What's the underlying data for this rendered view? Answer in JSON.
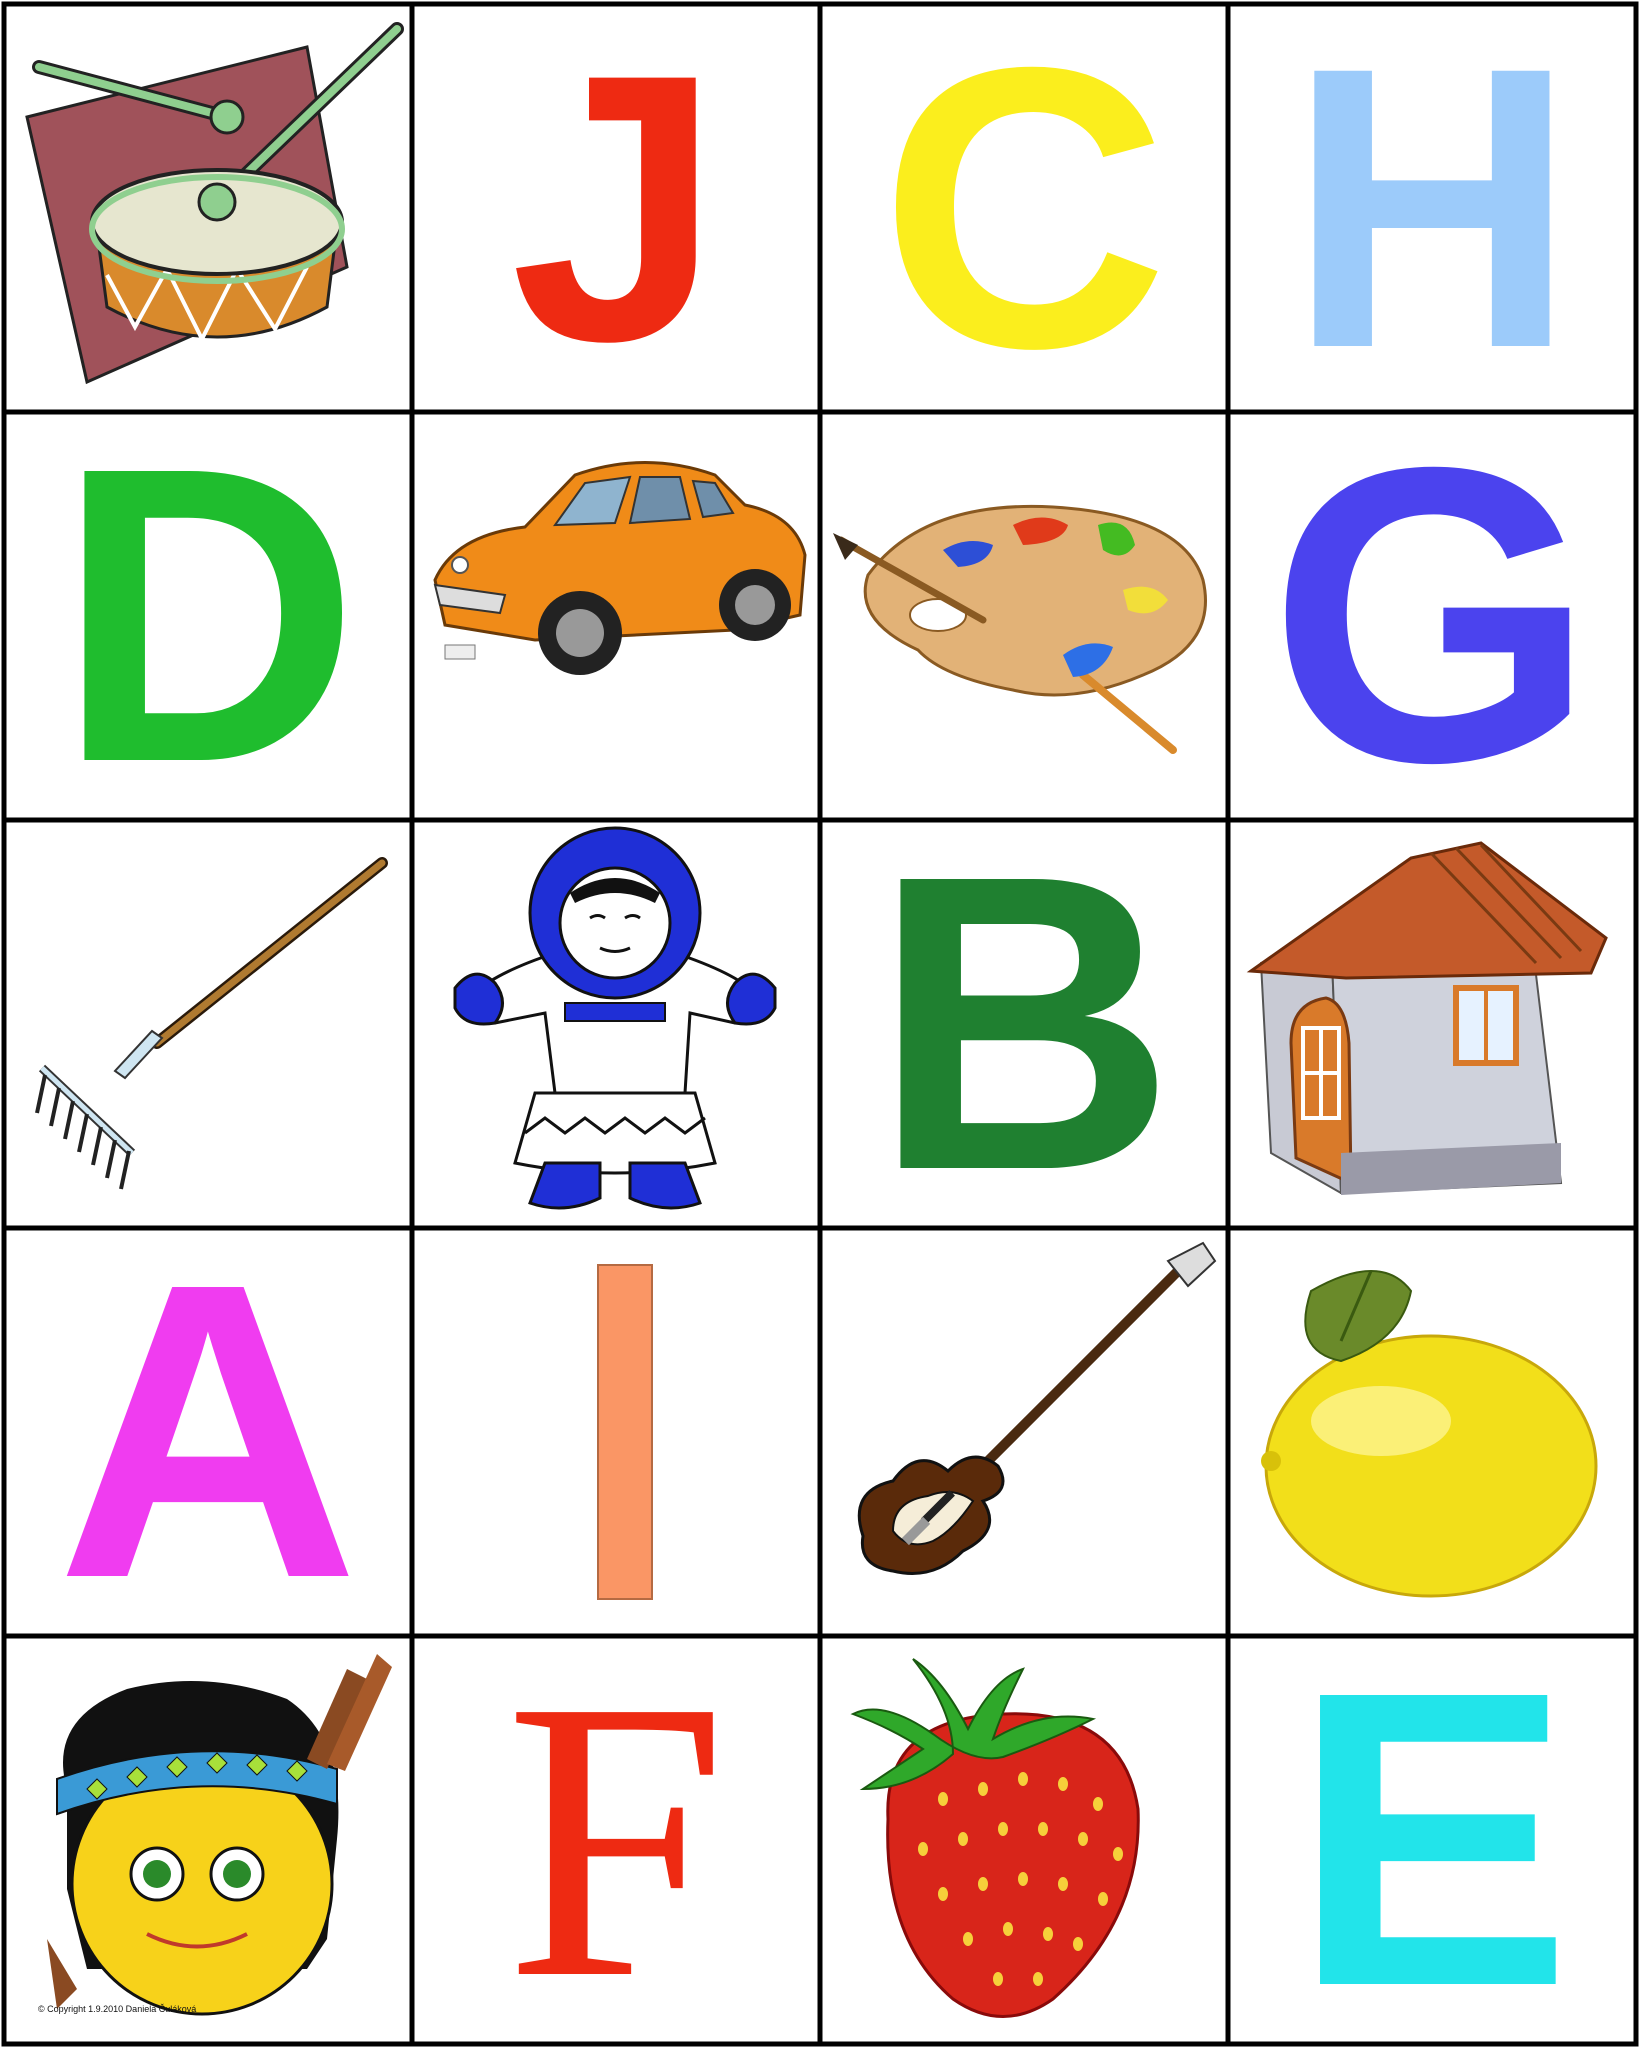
{
  "colors": {
    "grid_lines": "#000000",
    "background": "#ffffff"
  },
  "cards": [
    {
      "kind": "picture",
      "icon": "drum-icon"
    },
    {
      "kind": "letter",
      "letter": "J",
      "color": "#ee2a12"
    },
    {
      "kind": "letter",
      "letter": "C",
      "color": "#fbee1d"
    },
    {
      "kind": "letter",
      "letter": "H",
      "color": "#9ccbfa"
    },
    {
      "kind": "letter",
      "letter": "D",
      "color": "#1fbd2e"
    },
    {
      "kind": "picture",
      "icon": "car-icon"
    },
    {
      "kind": "picture",
      "icon": "paint-palette-icon"
    },
    {
      "kind": "letter",
      "letter": "G",
      "color": "#4b43ee"
    },
    {
      "kind": "picture",
      "icon": "rake-icon"
    },
    {
      "kind": "picture",
      "icon": "eskimo-icon"
    },
    {
      "kind": "letter",
      "letter": "B",
      "color": "#1f8030"
    },
    {
      "kind": "picture",
      "icon": "house-icon"
    },
    {
      "kind": "letter",
      "letter": "A",
      "color": "#f03cf0"
    },
    {
      "kind": "letter",
      "letter": "I",
      "color": "#fa9665"
    },
    {
      "kind": "picture",
      "icon": "guitar-icon"
    },
    {
      "kind": "picture",
      "icon": "lemon-icon"
    },
    {
      "kind": "picture",
      "icon": "indian-smiley-icon"
    },
    {
      "kind": "letter",
      "letter": "F",
      "color": "#ee2a12",
      "serif": true
    },
    {
      "kind": "picture",
      "icon": "strawberry-icon"
    },
    {
      "kind": "letter",
      "letter": "E",
      "color": "#22e4ea"
    }
  ],
  "copyright": "© Copyright 1.9.2010   Daniela Čuláková"
}
